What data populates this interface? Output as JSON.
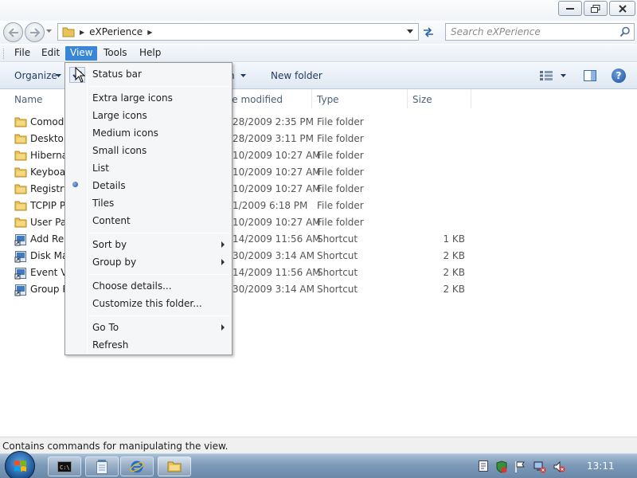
{
  "window": {
    "controls": [
      "minimize",
      "restore",
      "close"
    ]
  },
  "address": {
    "path_segment": "eXPerience",
    "search_placeholder": "Search eXPerience"
  },
  "menubar": {
    "items": [
      {
        "label": "File"
      },
      {
        "label": "Edit"
      },
      {
        "label": "View",
        "active": true
      },
      {
        "label": "Tools"
      },
      {
        "label": "Help"
      }
    ]
  },
  "commandbar": {
    "organize": "Organize",
    "new_folder": "New folder"
  },
  "columns": {
    "name": "Name",
    "date_modified": "Date modified",
    "type": "Type",
    "size": "Size"
  },
  "files": [
    {
      "name": "Comodo",
      "date": "28/2009 2:35 PM",
      "type": "File folder",
      "size": "",
      "icon": "folder-icon"
    },
    {
      "name": "Desktop",
      "date": "28/2009 3:11 PM",
      "type": "File folder",
      "size": "",
      "icon": "folder-icon"
    },
    {
      "name": "Hibernat",
      "date": "10/2009 10:27 AM",
      "type": "File folder",
      "size": "",
      "icon": "folder-icon"
    },
    {
      "name": "Keyboar",
      "date": "10/2009 10:27 AM",
      "type": "File folder",
      "size": "",
      "icon": "folder-icon"
    },
    {
      "name": "Registry",
      "date": "10/2009 10:27 AM",
      "type": "File folder",
      "size": "",
      "icon": "folder-icon"
    },
    {
      "name": "TCPIP P",
      "date": "1/2009 6:18 PM",
      "type": "File folder",
      "size": "",
      "icon": "folder-icon"
    },
    {
      "name": "User Pas",
      "date": "10/2009 10:27 AM",
      "type": "File folder",
      "size": "",
      "icon": "folder-icon"
    },
    {
      "name": "Add Rer",
      "date": "14/2009 11:56 AM",
      "type": "Shortcut",
      "size": "1 KB",
      "icon": "shortcut-icon"
    },
    {
      "name": "Disk Ma",
      "date": "30/2009 3:14 AM",
      "type": "Shortcut",
      "size": "2 KB",
      "icon": "shortcut-icon"
    },
    {
      "name": "Event Vi",
      "date": "14/2009 11:56 AM",
      "type": "Shortcut",
      "size": "2 KB",
      "icon": "shortcut-icon"
    },
    {
      "name": "Group P",
      "date": "30/2009 3:14 AM",
      "type": "Shortcut",
      "size": "2 KB",
      "icon": "shortcut-icon"
    }
  ],
  "view_menu": {
    "status_bar": "Status bar",
    "extra_large_icons": "Extra large icons",
    "large_icons": "Large icons",
    "medium_icons": "Medium icons",
    "small_icons": "Small icons",
    "list": "List",
    "details": "Details",
    "tiles": "Tiles",
    "content": "Content",
    "sort_by": "Sort by",
    "group_by": "Group by",
    "choose_details": "Choose details...",
    "customize_folder": "Customize this folder...",
    "go_to": "Go To",
    "refresh": "Refresh",
    "checked_item": "Status bar",
    "selected_view": "Details"
  },
  "statusbar": {
    "text": "Contains commands for manipulating the view."
  },
  "taskbar": {
    "clock": "13:11",
    "buttons": [
      "cmd-icon",
      "notepad-icon",
      "internet-explorer-icon",
      "explorer-icon"
    ],
    "tray": [
      "action-center-icon",
      "security-icon",
      "flag-icon",
      "network-icon",
      "volume-muted-icon"
    ]
  },
  "colors": {
    "menu_highlight": "#3a86d6",
    "taskbar": "#7c99b8",
    "folder": "#e8c35a"
  }
}
